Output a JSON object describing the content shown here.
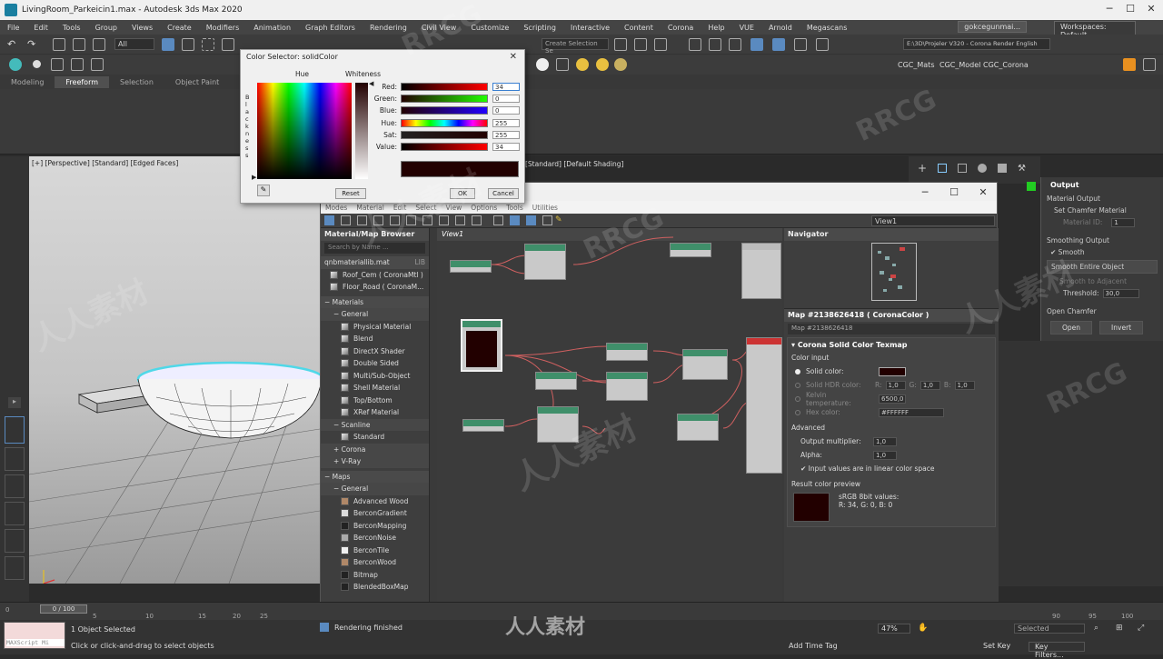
{
  "window": {
    "title": "LivingRoom_Parkeicin1.max - Autodesk 3ds Max 2020"
  },
  "menu": [
    "File",
    "Edit",
    "Tools",
    "Group",
    "Views",
    "Create",
    "Modifiers",
    "Animation",
    "Graph Editors",
    "Rendering",
    "Civil View",
    "Customize",
    "Scripting",
    "Interactive",
    "Content",
    "Corona",
    "Help",
    "VUE",
    "Arnold",
    "Megascans"
  ],
  "user": "gokcegunmai...",
  "workspace": "Workspaces: Default",
  "toolbar": {
    "selection_filter": "All",
    "create_selection_set": "Create Selection Se",
    "project_path": "E:\\3D\\Projeler V320 - Corona Render English",
    "tabs": [
      "CGC_Mats",
      "CGC_Model",
      "CGC_Corona"
    ]
  },
  "ribbon_tabs": [
    "Modeling",
    "Freeform",
    "Selection",
    "Object Paint"
  ],
  "viewport": {
    "label": "[+] [Perspective] [Standard] [Edged Faces]",
    "label2": "[Standard] [Default Shading]"
  },
  "color_selector": {
    "title": "Color Selector: solidColor",
    "hue_label": "Hue",
    "whiteness_label": "Whiteness",
    "blackness_letters": [
      "B",
      "l",
      "a",
      "c",
      "k",
      "n",
      "e",
      "s",
      "s"
    ],
    "channels": [
      {
        "label": "Red:",
        "value": "34"
      },
      {
        "label": "Green:",
        "value": "0"
      },
      {
        "label": "Blue:",
        "value": "0"
      },
      {
        "label": "Hue:",
        "value": "255"
      },
      {
        "label": "Sat:",
        "value": "255"
      },
      {
        "label": "Value:",
        "value": "34"
      }
    ],
    "preview_color": "#220000",
    "reset_label": "Reset",
    "ok_label": "OK",
    "cancel_label": "Cancel"
  },
  "sme": {
    "menu": [
      "Modes",
      "Material",
      "Edit",
      "Select",
      "View",
      "Options",
      "Tools",
      "Utilities"
    ],
    "view_dropdown": "View1",
    "browser": {
      "title": "Material/Map Browser",
      "search_placeholder": "Search by Name ...",
      "library": {
        "name": "qnbmateriallib.mat",
        "tag": "LIB"
      },
      "library_items": [
        "Roof_Cem  ( CoronaMtl )",
        "Floor_Road  ( CoronaM..."
      ],
      "materials_header": "Materials",
      "general_header": "General",
      "general_items": [
        "Physical Material",
        "Blend",
        "DirectX Shader",
        "Double Sided",
        "Multi/Sub-Object",
        "Shell Material",
        "Top/Bottom",
        "XRef Material"
      ],
      "scanline_header": "Scanline",
      "scanline_items": [
        "Standard"
      ],
      "corona_header": "+ Corona",
      "vray_header": "+ V-Ray",
      "maps_header": "Maps",
      "maps_general": "General",
      "map_items": [
        {
          "label": "Advanced Wood",
          "swatch": "sw-brown"
        },
        {
          "label": "BerconGradient",
          "swatch": "sw-light"
        },
        {
          "label": "BerconMapping",
          "swatch": "sw-dark"
        },
        {
          "label": "BerconNoise",
          "swatch": "sw-grey"
        },
        {
          "label": "BerconTile",
          "swatch": "sw-white"
        },
        {
          "label": "BerconWood",
          "swatch": "sw-brown"
        },
        {
          "label": "Bitmap",
          "swatch": "sw-dark"
        },
        {
          "label": "BlendedBoxMap",
          "swatch": "sw-dark"
        }
      ]
    },
    "view_tab": "View1",
    "navigator_title": "Navigator",
    "params": {
      "title": "Map #2138626418  ( CoronaColor )",
      "name_field": "Map #2138626418",
      "rollout_title": "Corona Solid Color Texmap",
      "color_input": "Color input",
      "solid_color": "Solid color:",
      "solid_hdr": "Solid HDR color:",
      "r_label": "R:",
      "g_label": "G:",
      "b_label": "B:",
      "hdr_r": "1,0",
      "hdr_g": "1,0",
      "hdr_b": "1,0",
      "kelvin": "Kelvin temperature:",
      "kelvin_value": "6500,0",
      "hex": "Hex color:",
      "hex_value": "#FFFFFF",
      "advanced": "Advanced",
      "output_mult": "Output multiplier:",
      "output_mult_value": "1,0",
      "alpha": "Alpha:",
      "alpha_value": "1,0",
      "linear": "Input values are in linear color space",
      "preview_title": "Result color preview",
      "srgb_title": "sRGB 8bit values:",
      "srgb_values": "R: 34, G: 0, B: 0"
    },
    "status": "Rendering finished"
  },
  "right_panel": {
    "output": "Output",
    "material_output": "Material Output",
    "set_chamfer": "Set Chamfer Material",
    "material_id": "Material ID:",
    "material_id_value": "1",
    "smoothing_output": "Smoothing Output",
    "smooth": "Smooth",
    "smooth_entire": "Smooth Entire Object",
    "smooth_adjacent": "Smooth to Adjacent",
    "threshold": "Threshold:",
    "threshold_value": "30,0",
    "open_chamfer": "Open Chamfer",
    "open": "Open",
    "invert": "Invert"
  },
  "timeline": {
    "frame": "0 / 100",
    "ticks": [
      "0",
      "5",
      "10",
      "15",
      "20",
      "25",
      "90",
      "95",
      "100"
    ]
  },
  "status": {
    "maxscript": "MAXScript Mi",
    "selected": "1 Object Selected",
    "hint": "Click or click-and-drag to select objects",
    "zoom": "47%",
    "add_time_tag": "Add Time Tag",
    "set_key": "Set Key",
    "key_filters": "Key Filters...",
    "selected_dropdown": "Selected"
  },
  "watermarks": [
    "RRCG",
    "人人素材",
    "RRCG",
    "人人素材",
    "RRCG",
    "人人素材",
    "RRCG",
    "人人素材",
    "人人素材"
  ]
}
